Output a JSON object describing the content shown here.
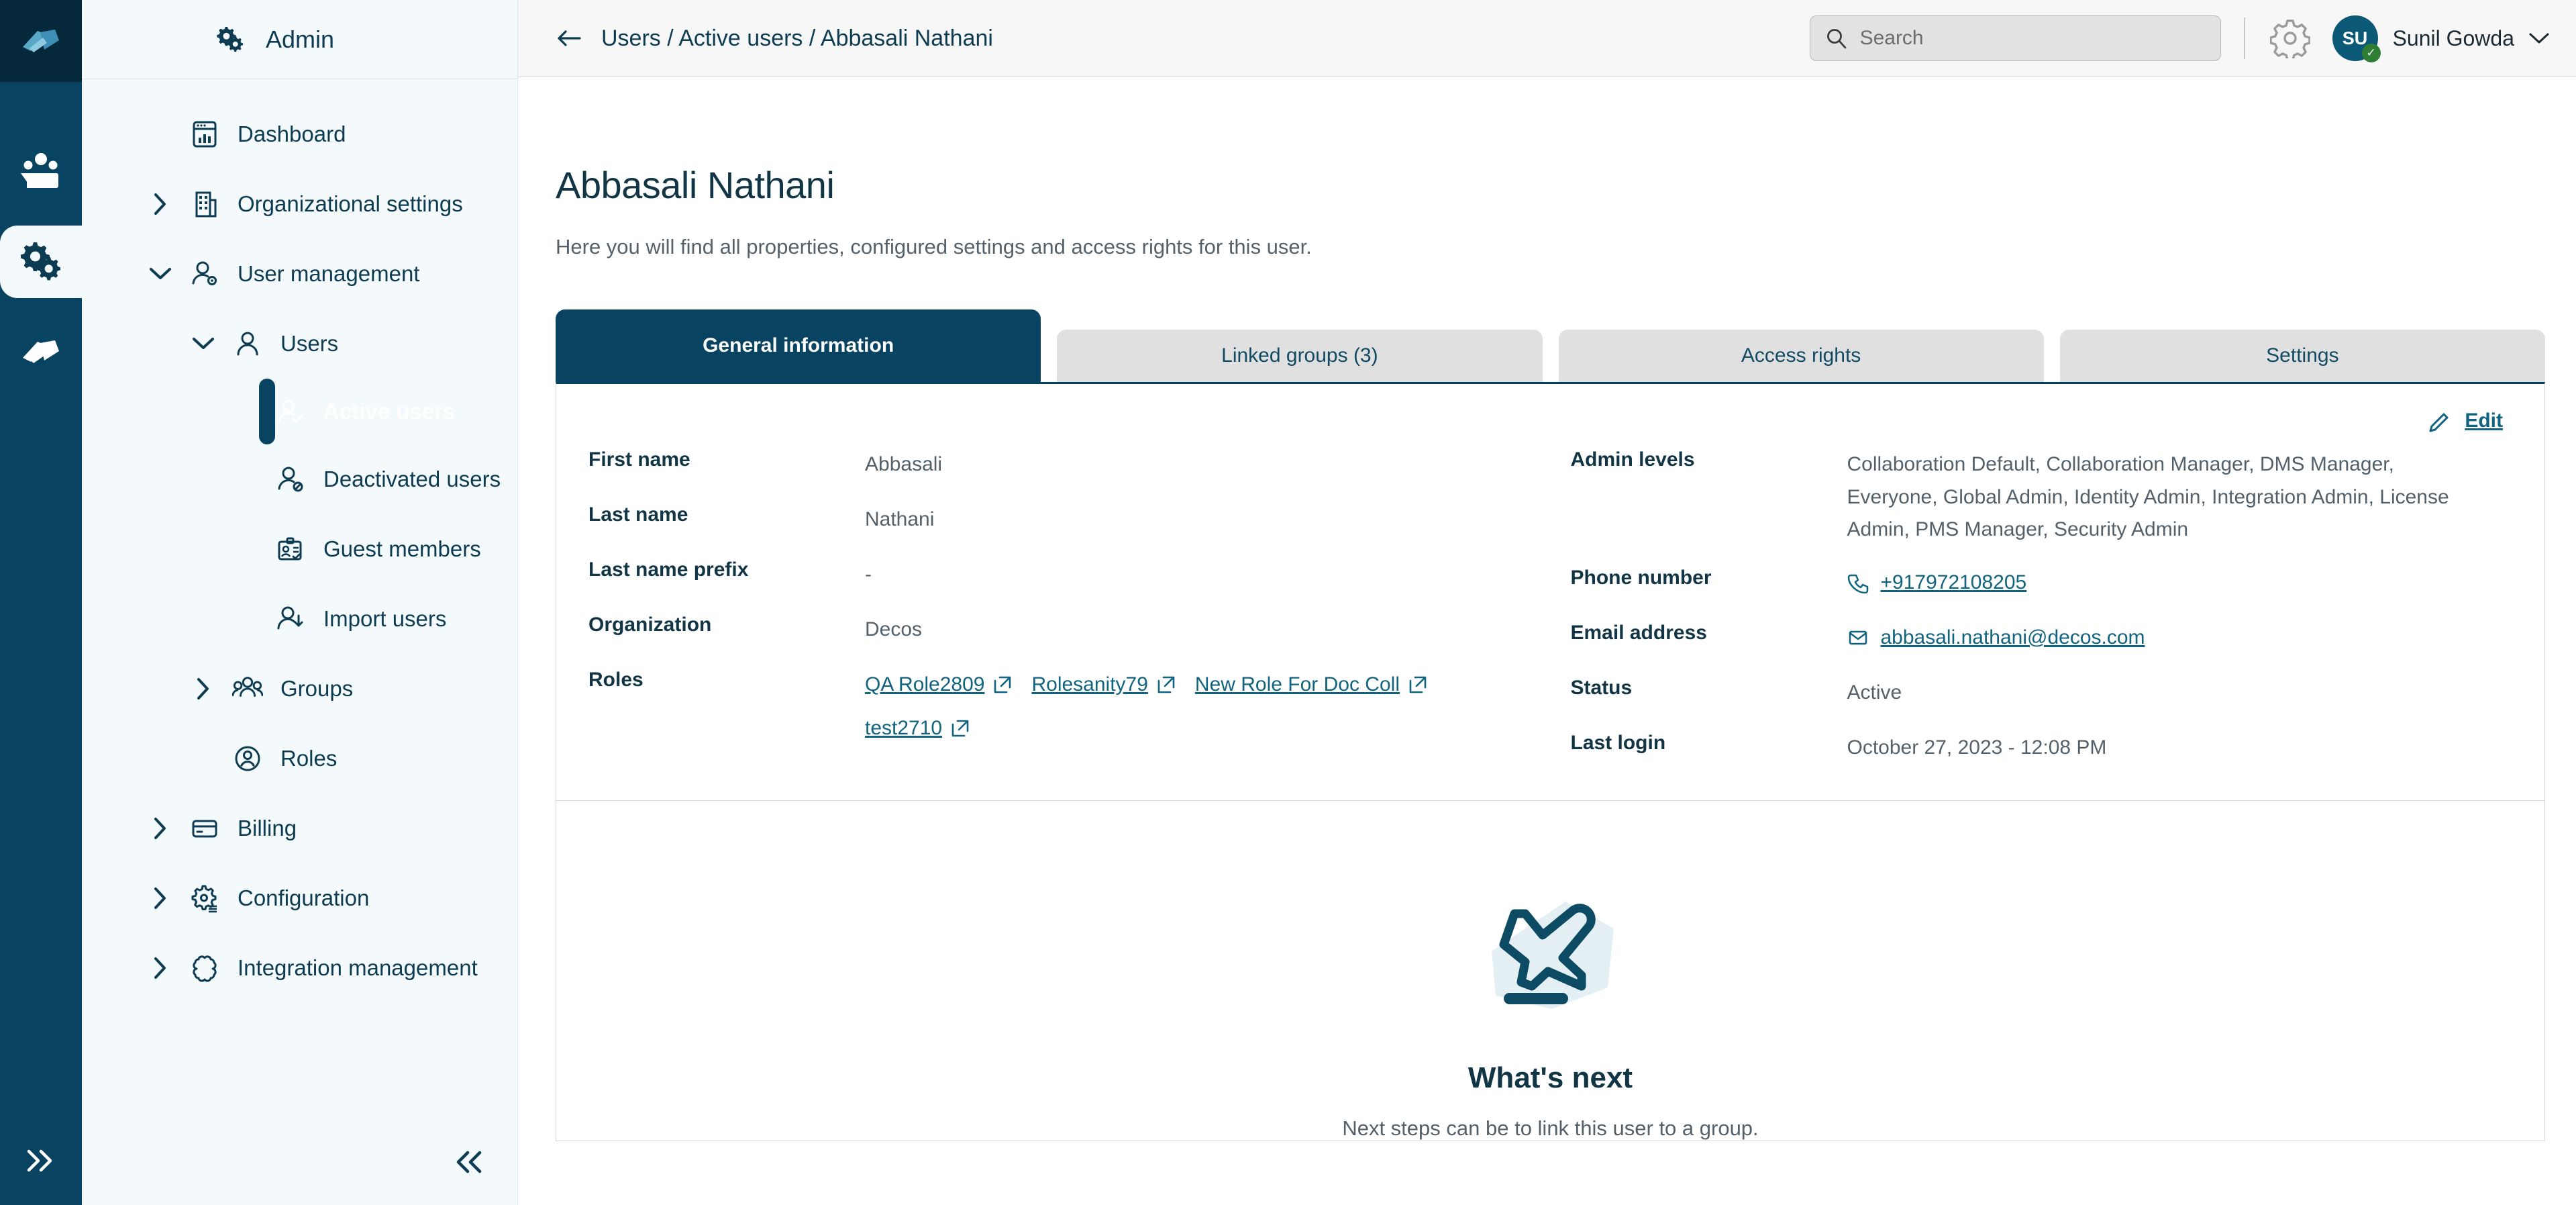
{
  "rail": {
    "logo_icon": "decos-logo-icon",
    "items": [
      {
        "icon": "team-folder-icon",
        "name": "rail-item-team"
      },
      {
        "icon": "gears-icon",
        "name": "rail-item-admin",
        "active": true
      },
      {
        "icon": "document-stack-icon",
        "name": "rail-item-documents"
      }
    ],
    "expand_label": "»"
  },
  "sidebar": {
    "title": "Admin",
    "title_icon": "gears-icon",
    "collapse_label": "«",
    "items": [
      {
        "label": "Dashboard",
        "icon": "dashboard-icon",
        "level": 0,
        "chevron": "none"
      },
      {
        "label": "Organizational settings",
        "icon": "building-icon",
        "level": 0,
        "chevron": "right"
      },
      {
        "label": "User management",
        "icon": "user-gear-icon",
        "level": 0,
        "chevron": "down"
      },
      {
        "label": "Users",
        "icon": "user-icon",
        "level": 1,
        "chevron": "down"
      },
      {
        "label": "Active users",
        "icon": "user-check-icon",
        "level": 2,
        "chevron": "none",
        "active": true
      },
      {
        "label": "Deactivated users",
        "icon": "user-block-icon",
        "level": 2,
        "chevron": "none"
      },
      {
        "label": "Guest members",
        "icon": "id-card-icon",
        "level": 2,
        "chevron": "none"
      },
      {
        "label": "Import users",
        "icon": "user-import-icon",
        "level": 2,
        "chevron": "none"
      },
      {
        "label": "Groups",
        "icon": "group-icon",
        "level": 1,
        "chevron": "right"
      },
      {
        "label": "Roles",
        "icon": "user-circle-icon",
        "level": 1,
        "chevron": "none"
      },
      {
        "label": "Billing",
        "icon": "card-icon",
        "level": 0,
        "chevron": "right"
      },
      {
        "label": "Configuration",
        "icon": "gear-list-icon",
        "level": 0,
        "chevron": "right"
      },
      {
        "label": "Integration management",
        "icon": "puzzle-icon",
        "level": 0,
        "chevron": "right"
      }
    ]
  },
  "topbar": {
    "back_icon": "arrow-left-icon",
    "breadcrumb": "Users / Active users / Abbasali Nathani",
    "search": {
      "placeholder": "Search",
      "value": "",
      "icon": "search-icon"
    },
    "settings_icon": "gear-icon",
    "user": {
      "initials": "SU",
      "name": "Sunil Gowda",
      "status_icon": "check-icon",
      "chevron_icon": "chevron-down-icon"
    }
  },
  "page": {
    "title": "Abbasali Nathani",
    "subtitle": "Here you will find all properties, configured settings and access rights for this user."
  },
  "tabs": [
    {
      "label": "General information",
      "active": true
    },
    {
      "label": "Linked groups (3)",
      "active": false
    },
    {
      "label": "Access rights",
      "active": false
    },
    {
      "label": "Settings",
      "active": false
    }
  ],
  "panel": {
    "edit_label": "Edit",
    "edit_icon": "pencil-icon",
    "left_fields": [
      {
        "key": "First name",
        "value": "Abbasali",
        "type": "text"
      },
      {
        "key": "Last name",
        "value": "Nathani",
        "type": "text"
      },
      {
        "key": "Last name prefix",
        "value": "-",
        "type": "text"
      },
      {
        "key": "Organization",
        "value": "Decos",
        "type": "text"
      }
    ],
    "roles_key": "Roles",
    "roles": [
      {
        "label": "QA Role2809",
        "icon": "external-link-icon"
      },
      {
        "label": "Rolesanity79",
        "icon": "external-link-icon"
      },
      {
        "label": "New Role For Doc Coll",
        "icon": "external-link-icon"
      },
      {
        "label": "test2710",
        "icon": "external-link-icon"
      }
    ],
    "right_fields": [
      {
        "key": "Admin levels",
        "value": "Collaboration Default, Collaboration Manager, DMS Manager, Everyone, Global Admin, Identity Admin, Integration Admin, License Admin, PMS Manager, Security Admin",
        "type": "multiline"
      },
      {
        "key": "Phone number",
        "value": "+917972108205",
        "type": "link",
        "icon": "phone-icon"
      },
      {
        "key": "Email address",
        "value": "abbasali.nathani@decos.com",
        "type": "link",
        "icon": "mail-icon"
      },
      {
        "key": "Status",
        "value": "Active",
        "type": "text"
      },
      {
        "key": "Last login",
        "value": "October 27, 2023 - 12:08 PM",
        "type": "text"
      }
    ]
  },
  "whats_next": {
    "illustration_icon": "paper-plane-icon",
    "title": "What's next",
    "subtitle": "Next steps can be to link this user to a group."
  },
  "colors": {
    "brand_dark": "#084461",
    "brand_darkest": "#05293b",
    "link": "#11647f",
    "sidebar_bg": "#f4f9fc",
    "tab_inactive": "#e0e0e0",
    "text_dark": "#123546",
    "text_muted": "#55616a",
    "status_green": "#2e7d32"
  }
}
